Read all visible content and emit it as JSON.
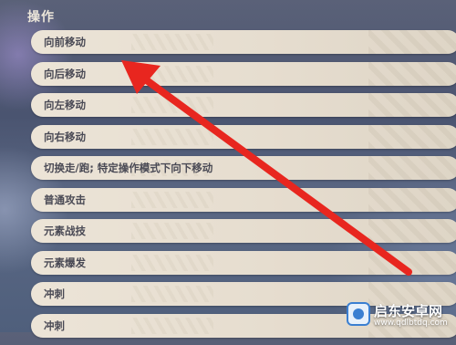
{
  "section": {
    "title": "操作"
  },
  "items": [
    {
      "label": "向前移动"
    },
    {
      "label": "向后移动"
    },
    {
      "label": "向左移动"
    },
    {
      "label": "向右移动"
    },
    {
      "label": "切换走/跑; 特定操作模式下向下移动"
    },
    {
      "label": "普通攻击"
    },
    {
      "label": "元素战技"
    },
    {
      "label": "元素爆发"
    },
    {
      "label": "冲刺"
    },
    {
      "label": "冲刺"
    }
  ],
  "colors": {
    "arrow": "#e8261f",
    "item_bg": "#e8dfd1",
    "item_text": "#4a4a55"
  },
  "watermark": {
    "brand": "启东安卓网",
    "url": "www.qdlbtdq.com"
  }
}
